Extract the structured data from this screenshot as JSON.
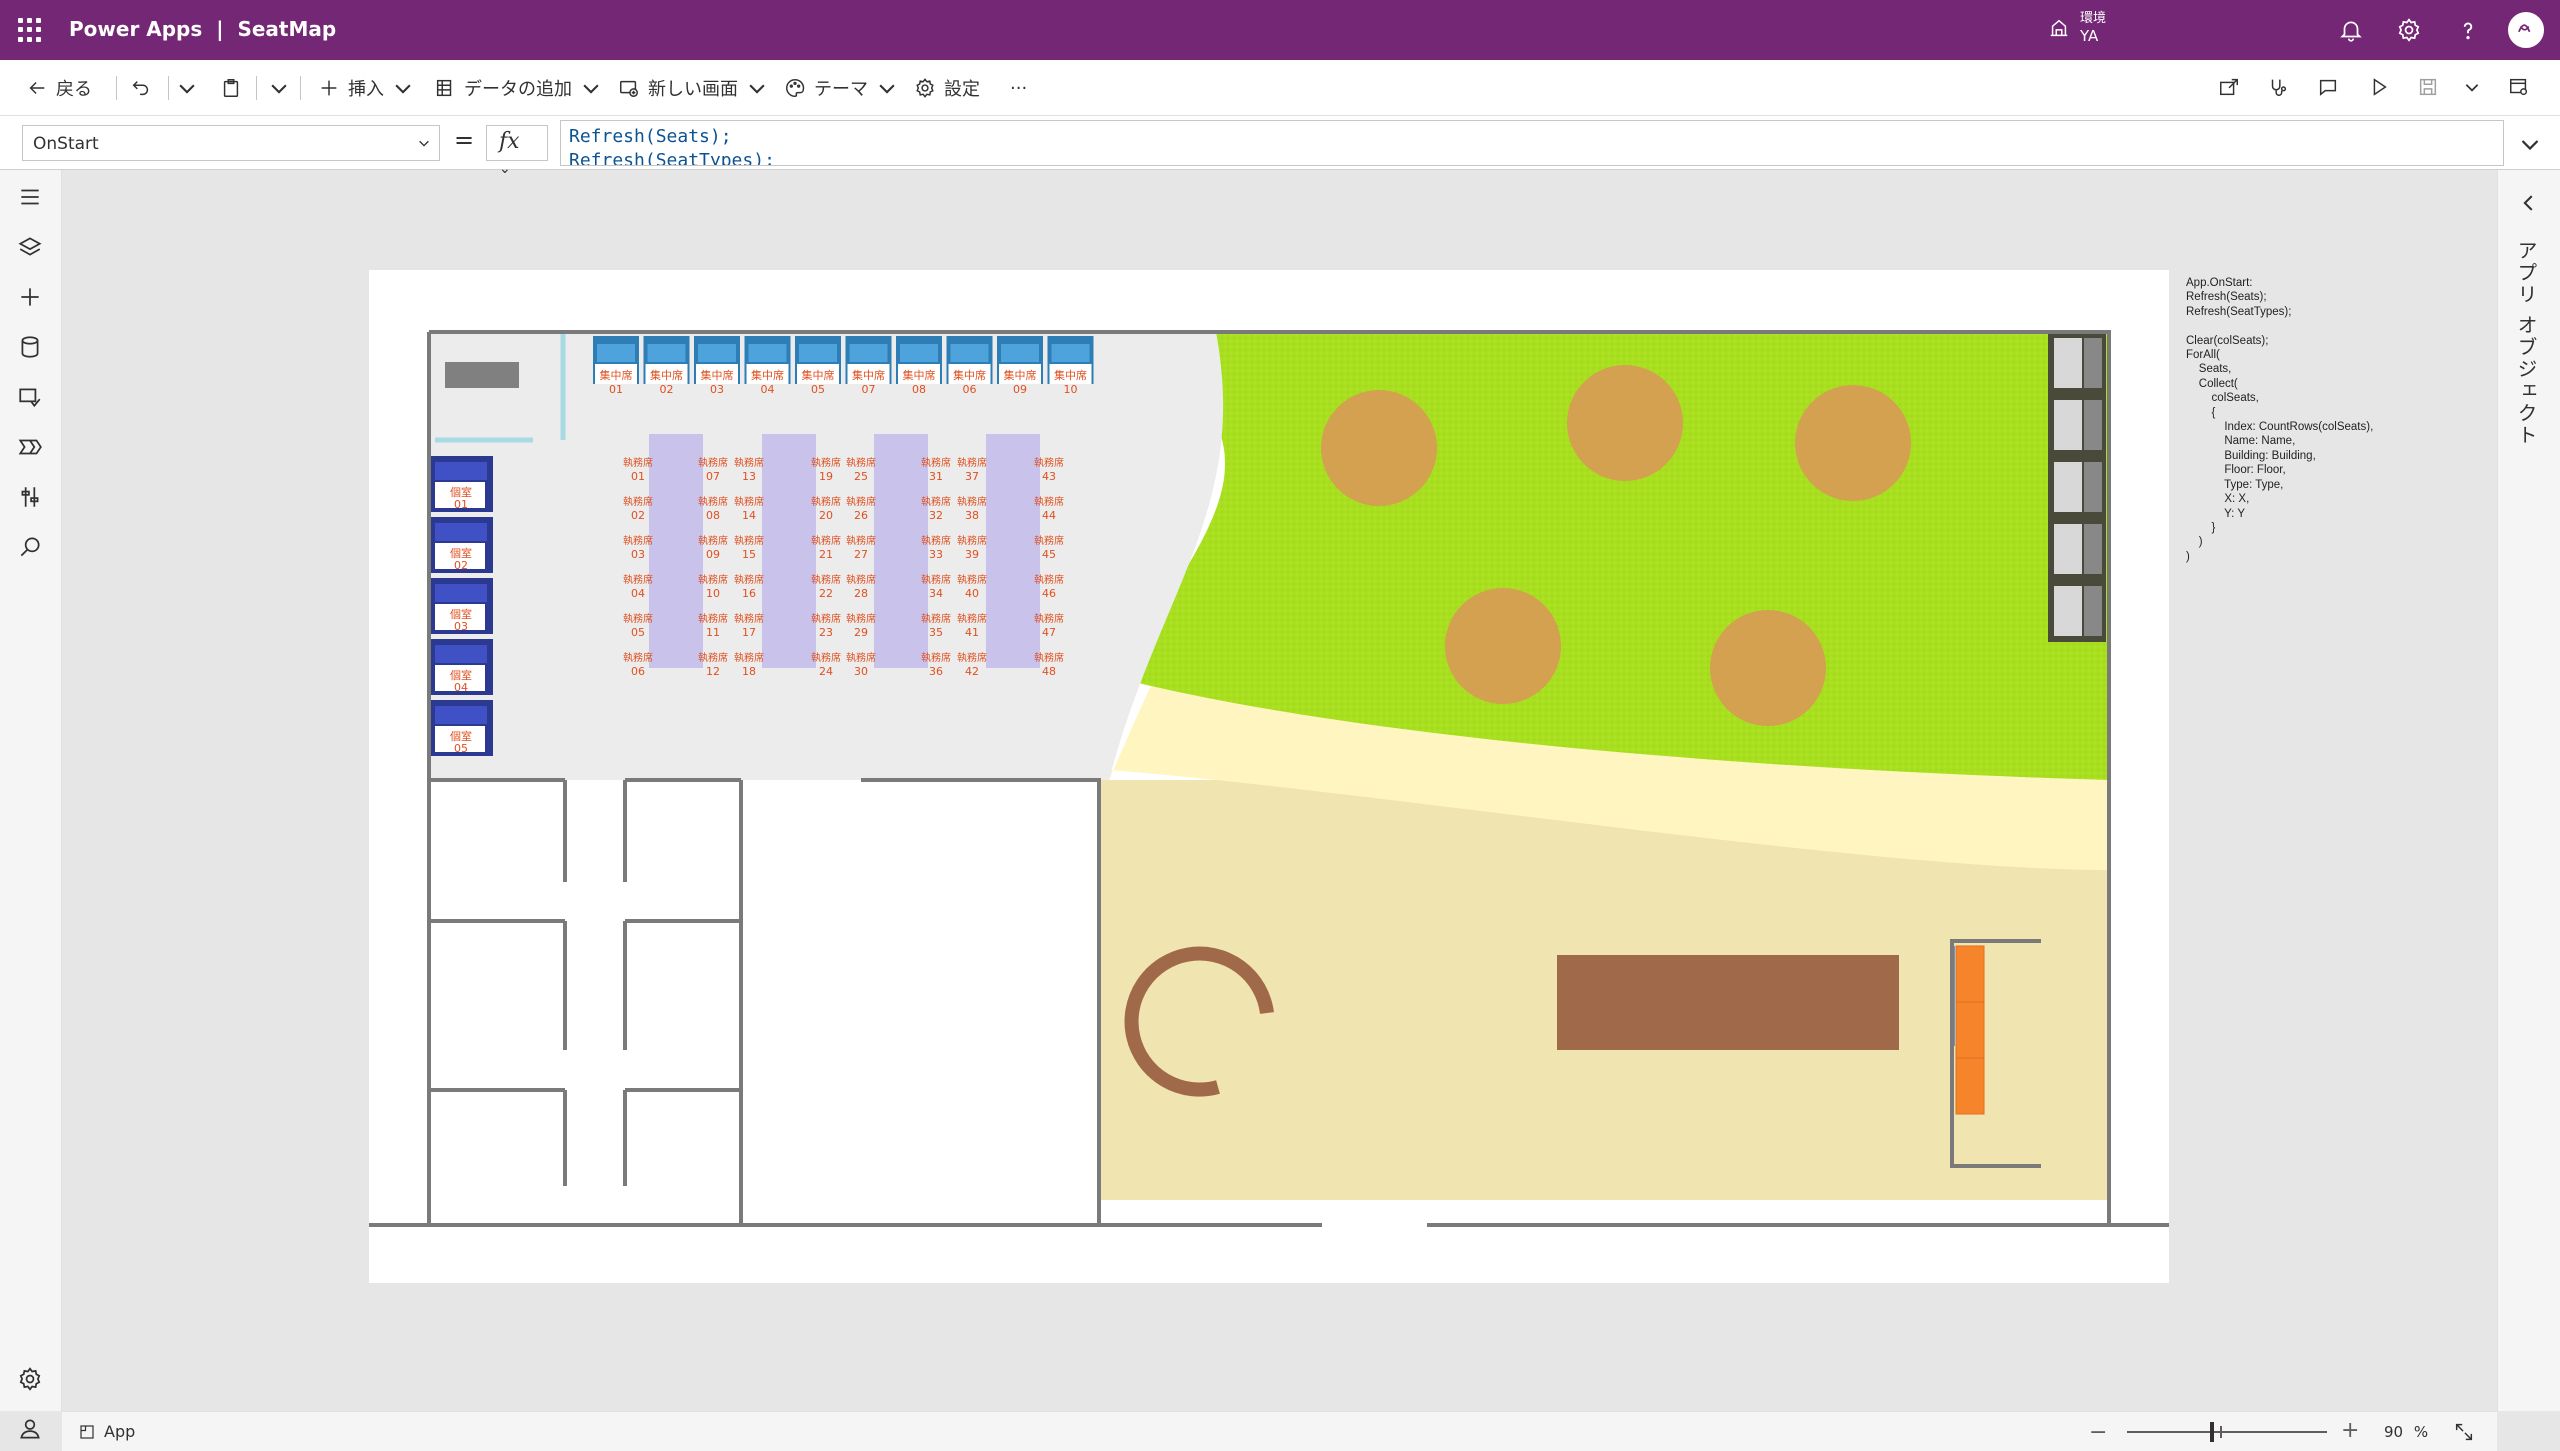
{
  "header": {
    "title": "Power Apps  |  SeatMap",
    "environment_label": "環境",
    "environment_value": "YA"
  },
  "commandbar": {
    "back": "戻る",
    "insert": "挿入",
    "add_data": "データの追加",
    "new_screen": "新しい画面",
    "theme": "テーマ",
    "settings": "設定",
    "more": "···"
  },
  "formulabar": {
    "property": "OnStart",
    "equals": "=",
    "fx": "fx",
    "line1": "Refresh(Seats);",
    "line2": "Refresh(SeatTypes);"
  },
  "rightpane": {
    "title": "アプリ オブジェクト"
  },
  "side_note": "App.OnStart:\nRefresh(Seats);\nRefresh(SeatTypes);\n\nClear(colSeats);\nForAll(\n    Seats,\n    Collect(\n        colSeats,\n        {\n            Index: CountRows(colSeats),\n            Name: Name,\n            Building: Building,\n            Floor: Floor,\n            Type: Type,\n            X: X,\n            Y: Y\n        }\n    )\n)",
  "statusbar": {
    "tree_label": "App",
    "zoom_minus": "−",
    "zoom_plus": "+",
    "zoom_value": "90 %"
  },
  "seatmap": {
    "colors": {
      "grass": "#a8e01f",
      "table": "#d3a150",
      "path": "#fff5c0",
      "floor": "#f0e4b0",
      "desk_column": "#c9c2ea",
      "booth": "#2e7db5",
      "room": "#2b3990",
      "seat_text": "#e05020",
      "wall": "#7a7a7a",
      "bench": "#a0694a",
      "sofa": "#f6842b"
    },
    "focus_label": "集中席",
    "focus_seats": [
      "01",
      "02",
      "03",
      "04",
      "05",
      "07",
      "08",
      "06",
      "09",
      "10"
    ],
    "room_label": "個室",
    "rooms": [
      "01",
      "02",
      "03",
      "04",
      "05"
    ],
    "desk_label": "執務席",
    "desk_columns": [
      [
        "01",
        "02",
        "03",
        "04",
        "05",
        "06"
      ],
      [
        "07",
        "08",
        "09",
        "10",
        "11",
        "12"
      ],
      [
        "13",
        "14",
        "15",
        "16",
        "17",
        "18"
      ],
      [
        "19",
        "20",
        "21",
        "22",
        "23",
        "24"
      ],
      [
        "25",
        "26",
        "27",
        "28",
        "29",
        "30"
      ],
      [
        "31",
        "32",
        "33",
        "34",
        "35",
        "36"
      ],
      [
        "37",
        "38",
        "39",
        "40",
        "41",
        "42"
      ],
      [
        "43",
        "44",
        "45",
        "46",
        "47",
        "48"
      ]
    ]
  }
}
